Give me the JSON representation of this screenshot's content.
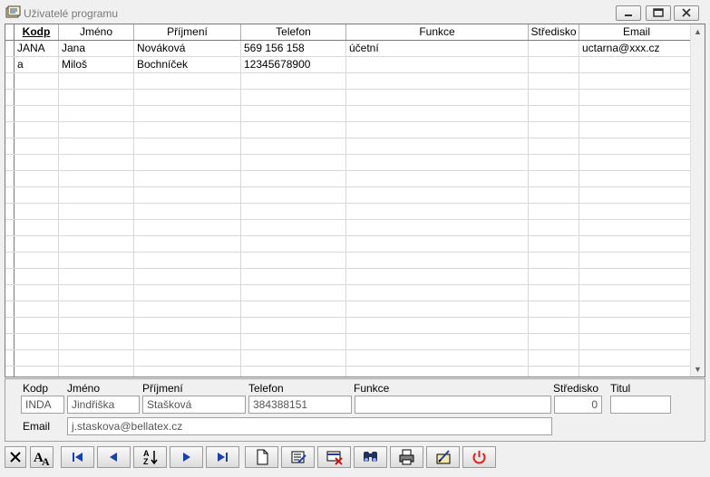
{
  "window": {
    "title": "Uživatelé programu",
    "icon": "users-app-icon",
    "controls": [
      "minimize-icon",
      "maximize-icon",
      "close-icon"
    ]
  },
  "grid": {
    "columns": [
      "Kodp",
      "Jméno",
      "Příjmení",
      "Telefon",
      "Funkce",
      "Středisko",
      "Email"
    ],
    "sorted_column": "Kodp",
    "rows": [
      {
        "kodp": "JANA",
        "jmeno": "Jana",
        "prijmeni": "Nováková",
        "telefon": "569 156 158",
        "funkce": "účetní",
        "stredisko": "",
        "email": "uctarna@xxx.cz"
      },
      {
        "kodp": "a",
        "jmeno": "Miloš",
        "prijmeni": "Bochníček",
        "telefon": "12345678900",
        "funkce": "",
        "stredisko": "",
        "email": ""
      }
    ]
  },
  "detail": {
    "labels": {
      "kodp": "Kodp",
      "jmeno": "Jméno",
      "prijmeni": "Příjmení",
      "telefon": "Telefon",
      "funkce": "Funkce",
      "stredisko": "Středisko",
      "titul": "Titul",
      "email": "Email"
    },
    "values": {
      "kodp": "INDA",
      "jmeno": "Jindřiška",
      "prijmeni": "Stašková",
      "telefon": "384388151",
      "funkce": "",
      "stredisko": "0",
      "titul": "",
      "email": "j.staskova@bellatex.cz"
    }
  },
  "toolbar": {
    "buttons": [
      "close-x-icon",
      "font-icon",
      "first-record-icon",
      "previous-record-icon",
      "sort-az-icon",
      "next-record-icon",
      "last-record-icon",
      "new-record-icon",
      "edit-record-icon",
      "delete-record-icon",
      "find-icon",
      "print-icon",
      "write-icon",
      "power-icon"
    ]
  },
  "colors": {
    "nav_blue": "#1c3fa8",
    "power_red": "#e02020",
    "delete_red": "#d01010"
  }
}
